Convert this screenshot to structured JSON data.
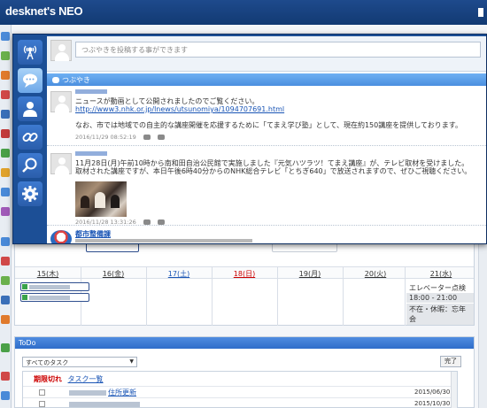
{
  "header": {
    "logo": "desknet's NEO"
  },
  "modal": {
    "nav": [
      {
        "name": "broadcast",
        "icon": "broadcast-icon"
      },
      {
        "name": "speech",
        "icon": "speech-bubble-icon"
      },
      {
        "name": "user",
        "icon": "user-icon"
      },
      {
        "name": "link",
        "icon": "link-icon"
      },
      {
        "name": "search",
        "icon": "search-icon"
      },
      {
        "name": "settings",
        "icon": "gear-icon"
      }
    ],
    "compose_placeholder": "つぶやきを投稿する事ができます",
    "section_title": "つぶやき",
    "posts": [
      {
        "lines": [
          "ニュースが動画として公開されましたのでご覧ください。"
        ],
        "link": "http://www3.nhk.or.jp/lnews/utsunomiya/1094707691.html",
        "extra": "なお、市では地域での自主的な講座開催を応援するために「てまえ学び塾」として、現在約150講座を提供しております。",
        "timestamp": "2016/11/29 08:52:19"
      },
      {
        "lines": [
          "11月28日(月)午前10時から南和田自治公民館で実施しました『元気ハツラツ！てまえ講座』が、テレビ取材を受けました。",
          "取材された講座ですが、本日午後6時40分からのNHK総合テレビ「とちぎ640」で放送されますので、ぜひご視聴ください。"
        ],
        "timestamp": "2016/11/28 13:31:26"
      },
      {
        "author": "都市整備課"
      }
    ]
  },
  "schedule": {
    "days": [
      {
        "label": "15(木)",
        "color": "#333333"
      },
      {
        "label": "16(金)",
        "color": "#333333"
      },
      {
        "label": "17(土)",
        "color": "#1a55b5"
      },
      {
        "label": "18(日)",
        "color": "#cc0000"
      },
      {
        "label": "19(月)",
        "color": "#333333"
      },
      {
        "label": "20(火)",
        "color": "#333333"
      },
      {
        "label": "21(水)",
        "color": "#333333"
      }
    ],
    "events": [
      {
        "text": "エレベーター点検"
      },
      {
        "text": "18:00 - 21:00"
      },
      {
        "text": "不在・休暇：忘年会"
      }
    ]
  },
  "todo": {
    "title": "ToDo",
    "filter": "すべてのタスク",
    "done_button": "完了",
    "overdue_label": "期限切れ",
    "task_list_link": "タスク一覧",
    "rows": [
      {
        "text": "住所更新",
        "date": "2015/06/30"
      },
      {
        "text": "",
        "date": "2015/10/30"
      }
    ]
  }
}
